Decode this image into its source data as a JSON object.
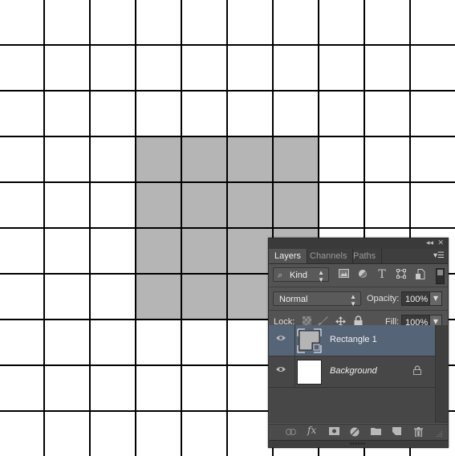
{
  "canvas": {
    "background": "#ffffff",
    "grid_color": "#000000",
    "shape_color": "#b5b5b5"
  },
  "panel": {
    "collapse_icon": "collapse-icon",
    "close_icon": "close-icon",
    "tabs": [
      {
        "label": "Layers",
        "active": true
      },
      {
        "label": "Channels",
        "active": false
      },
      {
        "label": "Paths",
        "active": false
      }
    ],
    "menu_icon": "panel-menu-icon",
    "filter": {
      "kind_label": "Kind",
      "icons": [
        "pixel-layer-filter-icon",
        "adjustment-layer-filter-icon",
        "type-layer-filter-icon",
        "shape-layer-filter-icon",
        "smart-object-filter-icon"
      ],
      "toggle": "filter-toggle"
    },
    "blend_mode": "Normal",
    "opacity_label": "Opacity:",
    "opacity_value": "100%",
    "lock_label": "Lock:",
    "lock_icons": [
      "lock-transparent-pixels-icon",
      "lock-image-pixels-icon",
      "lock-position-icon",
      "lock-all-icon"
    ],
    "fill_label": "Fill:",
    "fill_value": "100%",
    "layers": [
      {
        "name": "Rectangle 1",
        "selected": true,
        "visible": true,
        "type": "shape",
        "locked": false
      },
      {
        "name": "Background",
        "selected": false,
        "visible": true,
        "type": "background",
        "locked": true
      }
    ],
    "footer_icons": [
      "link-layers-icon",
      "fx-icon",
      "add-mask-icon",
      "new-adjustment-layer-icon",
      "new-group-icon",
      "new-layer-icon",
      "delete-layer-icon"
    ],
    "glyphs": {
      "collapse": "◂◂",
      "close": "✕",
      "menu": "▾☰",
      "search": "⌕",
      "updown": "▲\n▼",
      "down": "▼",
      "eye": "◉",
      "lock": "🔒",
      "type": "T",
      "fx": "fx",
      "trash": "🗑"
    }
  }
}
